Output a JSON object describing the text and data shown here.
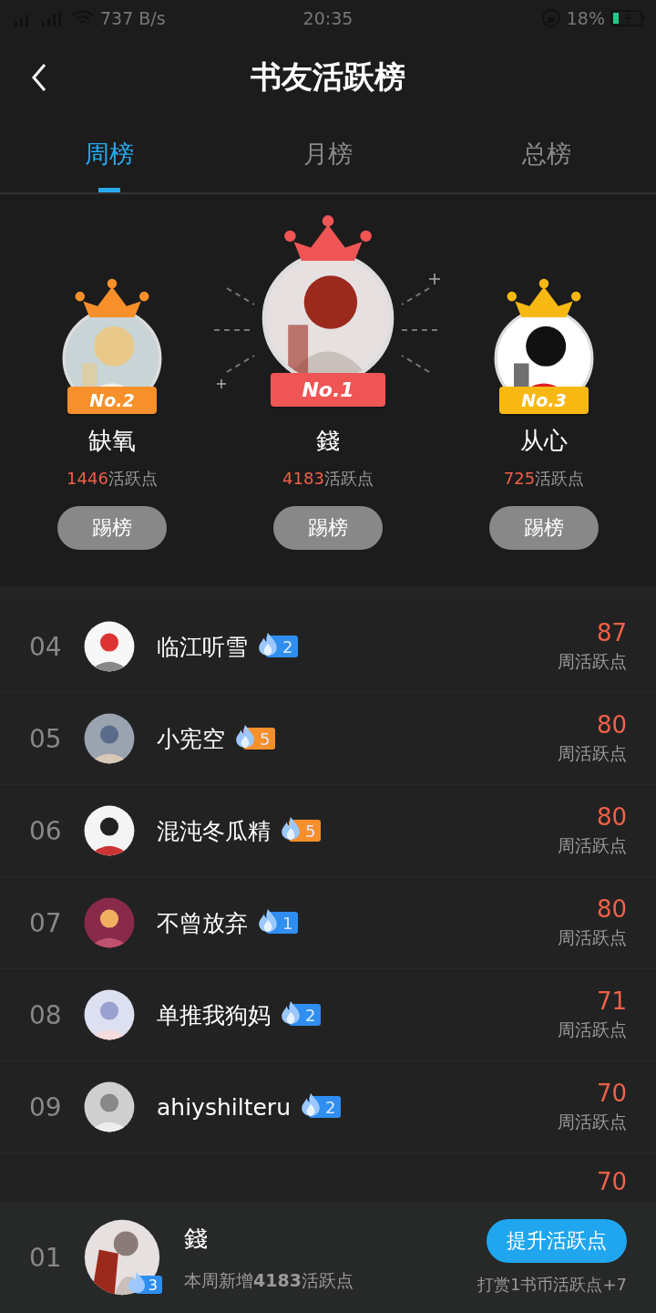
{
  "status_bar": {
    "speed": "737 B/s",
    "time": "20:35",
    "battery": "18%"
  },
  "header": {
    "title": "书友活跃榜"
  },
  "tabs": [
    {
      "label": "周榜",
      "selected": true
    },
    {
      "label": "月榜",
      "selected": false
    },
    {
      "label": "总榜",
      "selected": false
    }
  ],
  "podium": [
    {
      "rank": "No.2",
      "name": "缺氧",
      "points": "1446",
      "points_unit": "活跃点",
      "button": "踢榜",
      "color": "#f7902a"
    },
    {
      "rank": "No.1",
      "name": "錢",
      "points": "4183",
      "points_unit": "活跃点",
      "button": "踢榜",
      "color": "#f05555"
    },
    {
      "rank": "No.3",
      "name": "从心",
      "points": "725",
      "points_unit": "活跃点",
      "button": "踢榜",
      "color": "#f8b814"
    }
  ],
  "rows": [
    {
      "rank": "04",
      "name": "临江听雪",
      "level": "2",
      "color": "#2f8ef0",
      "score": "87",
      "score_label": "周活跃点"
    },
    {
      "rank": "05",
      "name": "小宪空",
      "level": "5",
      "color": "#f7902a",
      "score": "80",
      "score_label": "周活跃点"
    },
    {
      "rank": "06",
      "name": "混沌冬瓜精",
      "level": "5",
      "color": "#f7902a",
      "score": "80",
      "score_label": "周活跃点"
    },
    {
      "rank": "07",
      "name": "不曾放弃",
      "level": "1",
      "color": "#2f8ef0",
      "score": "80",
      "score_label": "周活跃点"
    },
    {
      "rank": "08",
      "name": "单推我狗妈",
      "level": "2",
      "color": "#2f8ef0",
      "score": "71",
      "score_label": "周活跃点"
    },
    {
      "rank": "09",
      "name": "ahiyshilteru",
      "level": "2",
      "color": "#2f8ef0",
      "score": "70",
      "score_label": "周活跃点"
    },
    {
      "score": "70"
    }
  ],
  "me": {
    "rank": "01",
    "name": "錢",
    "level": "3",
    "summary": "本周新增**4183**活跃点",
    "button": "提升活跃点",
    "hint": "打赏1书币活跃点+7"
  }
}
